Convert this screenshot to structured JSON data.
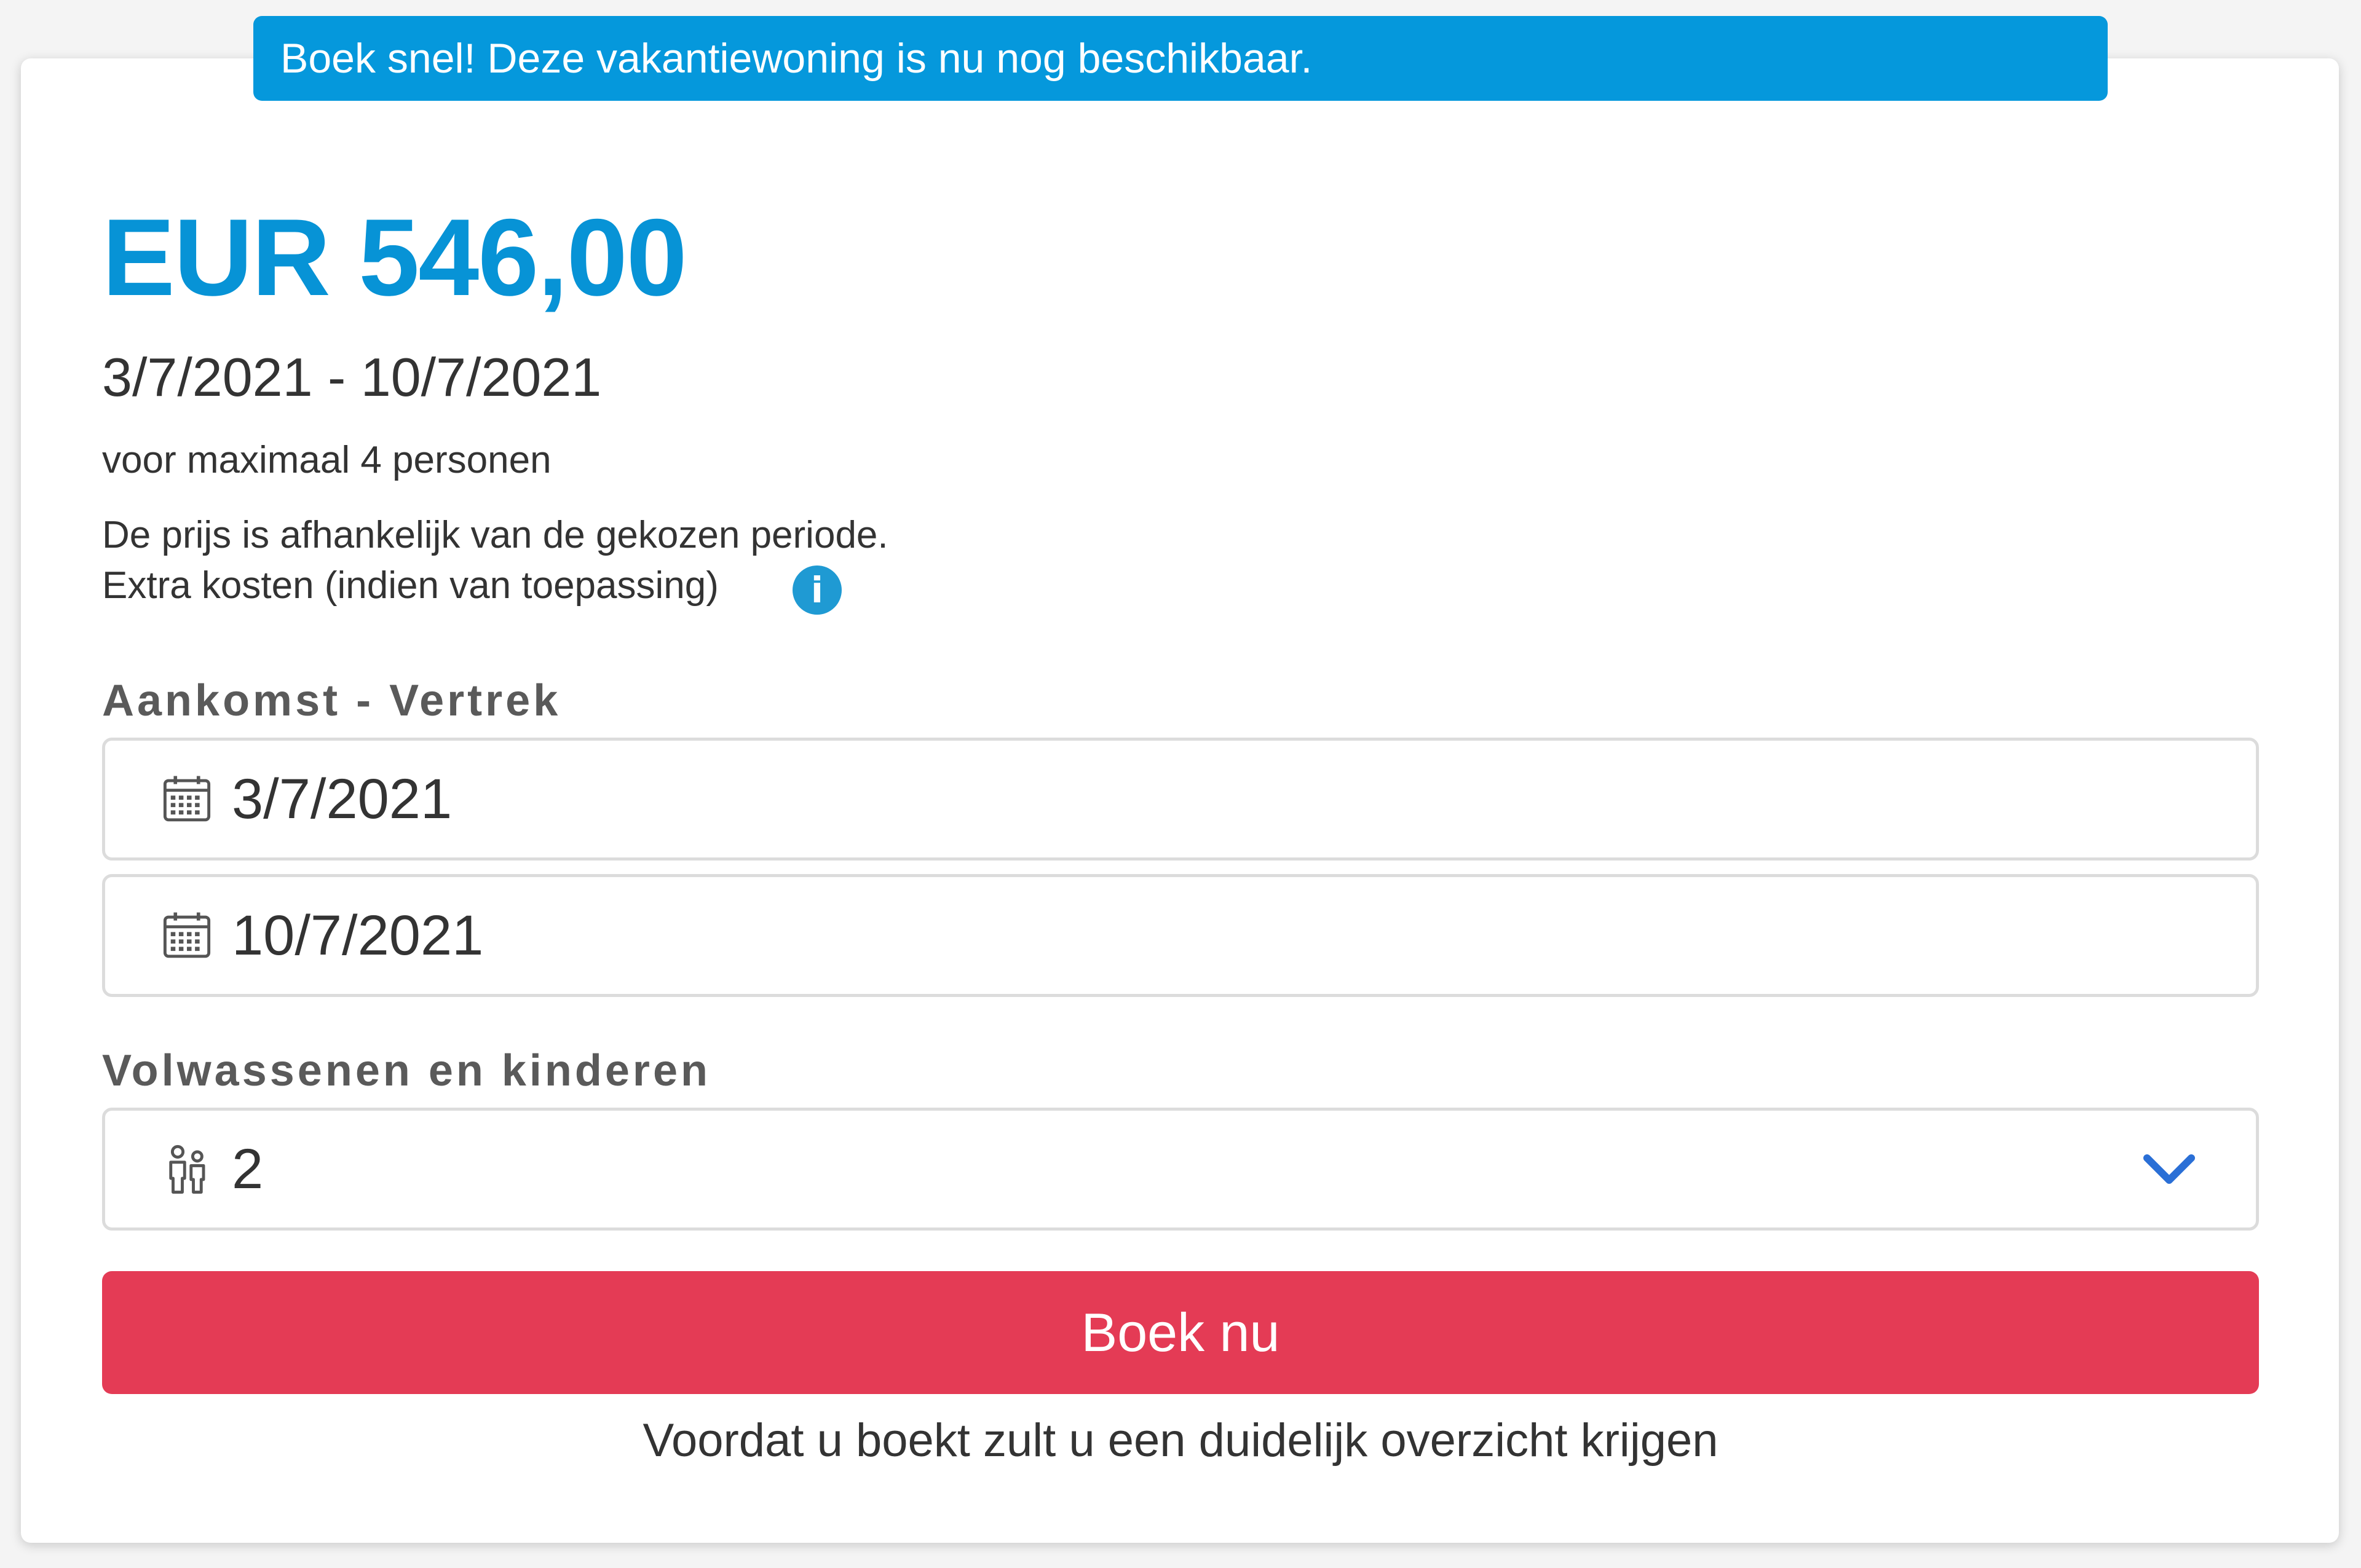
{
  "banner": {
    "text": "Boek snel! Deze vakantiewoning is nu nog beschikbaar."
  },
  "offer": {
    "price": "EUR 546,00",
    "date_range": "3/7/2021 - 10/7/2021",
    "max_persons": "voor maximaal 4 personen",
    "price_note": "De prijs is afhankelijk van de gekozen periode.",
    "extra_costs": "Extra kosten (indien van toepassing)",
    "info_icon_glyph": "i"
  },
  "dates": {
    "label": "Aankomst - Vertrek",
    "arrival": "3/7/2021",
    "departure": "10/7/2021",
    "icon": "calendar-icon"
  },
  "guests": {
    "label": "Volwassenen en kinderen",
    "value": "2",
    "icon": "people-icon",
    "dropdown_icon": "chevron-down-icon"
  },
  "booking": {
    "button_label": "Boek nu",
    "footnote": "Voordat u boekt zult u een duidelijk overzicht krijgen"
  },
  "colors": {
    "banner": "#0598dc",
    "price": "#0793d6",
    "book_button": "#e43b55",
    "chevron": "#2a6fd6",
    "info_icon": "#1f9ad3"
  }
}
